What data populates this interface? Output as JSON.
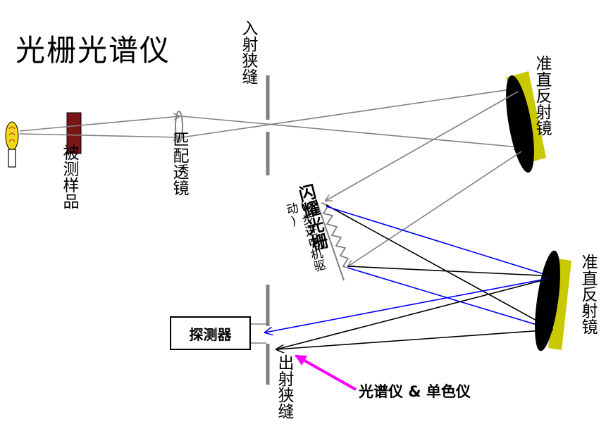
{
  "title": "光栅光谱仪",
  "labels": {
    "sample": "被测样品",
    "matching_lens": "匹配透镜",
    "entrance_slit": "入射狭缝",
    "collimator_top": "准直反射镜",
    "collimator_bottom": "准直反射镜",
    "grating": "闪耀光栅",
    "grating_note": "(步进电机驱动)",
    "detector": "探测器",
    "exit_slit": "出射狭缝",
    "caption": "光谱仪 & 单色仪"
  },
  "colors": {
    "mirror_coating": "#c9c900",
    "sample_block": "#7a1515",
    "gray_ray": "#808080",
    "blue_ray": "#0000ff",
    "black_ray": "#000000",
    "pointer_arrow": "#ff00ff",
    "bulb": "#f2d81a"
  },
  "icons": {
    "light_source": "light-bulb-icon"
  }
}
